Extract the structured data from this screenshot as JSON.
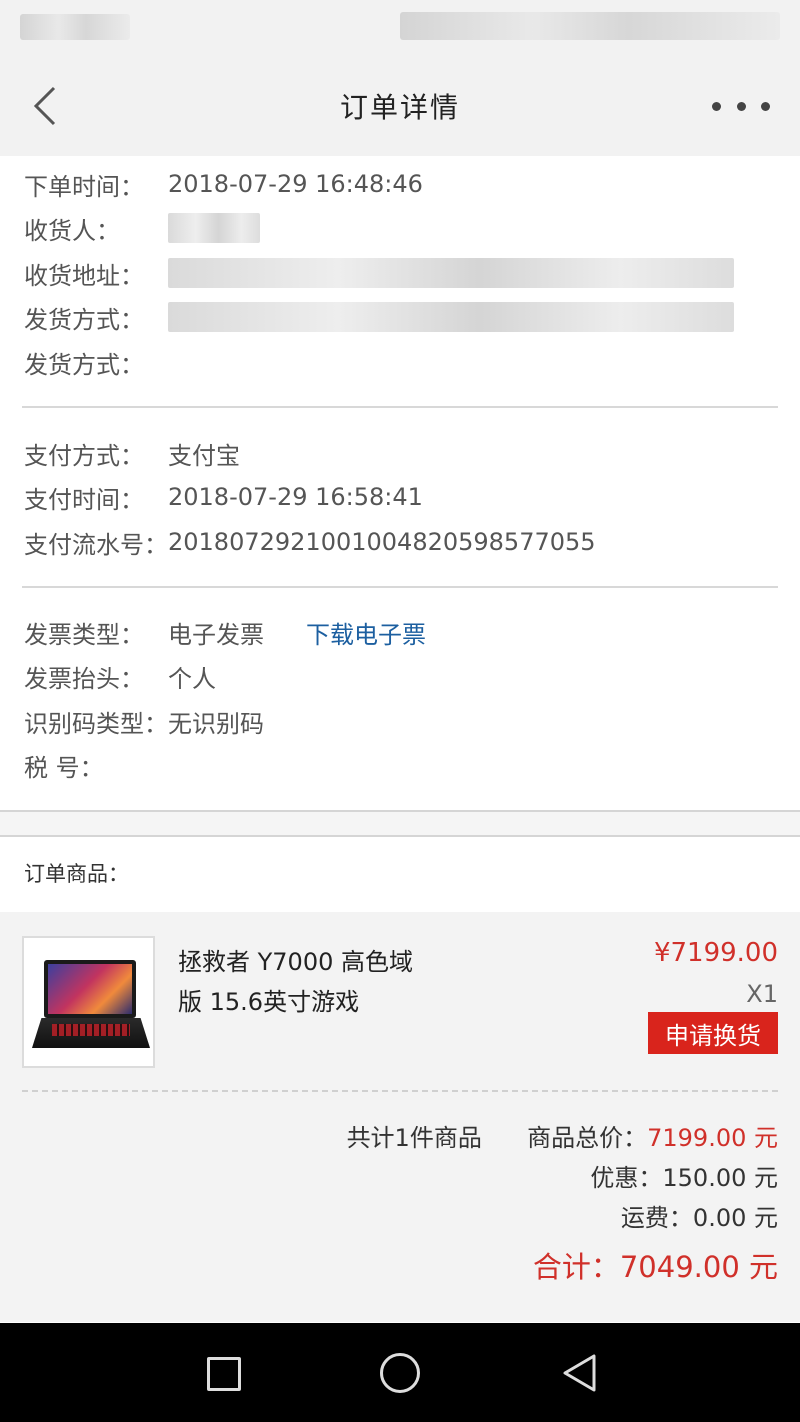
{
  "nav": {
    "title": "订单详情"
  },
  "order_info": {
    "order_time_label": "下单时间：",
    "order_time": "2018-07-29 16:48:46",
    "receiver_label": "收货人：",
    "address_label": "收货地址：",
    "ship_method_label": "发货方式：",
    "ship_method_label2": "发货方式："
  },
  "payment": {
    "method_label": "支付方式：",
    "method": "支付宝",
    "time_label": "支付时间：",
    "time": "2018-07-29 16:58:41",
    "serial_label": "支付流水号：",
    "serial": "2018072921001004820598577055"
  },
  "invoice": {
    "type_label": "发票类型：",
    "type": "电子发票",
    "download_link": "下载电子票",
    "title_label": "发票抬头：",
    "title": "个人",
    "idcode_type_label": "识别码类型：",
    "idcode_type": "无识别码",
    "tax_label": "税 号："
  },
  "items": {
    "label": "订单商品：",
    "products": [
      {
        "name": "拯救者 Y7000 高色域版 15.6英寸游戏",
        "price": "¥7199.00",
        "qty": "X1",
        "action": "申请换货"
      }
    ]
  },
  "summary": {
    "count_text": "共计1件商品",
    "goods_total_label": "商品总价：",
    "goods_total": "7199.00 元",
    "discount_label": "优惠：",
    "discount": "150.00 元",
    "shipping_label": "运费：",
    "shipping": "0.00 元",
    "grand_total_label": "合计：",
    "grand_total": "7049.00 元"
  },
  "colors": {
    "accent_red": "#d9241c",
    "price_red": "#d0302a",
    "link_blue": "#1c5fa0"
  }
}
